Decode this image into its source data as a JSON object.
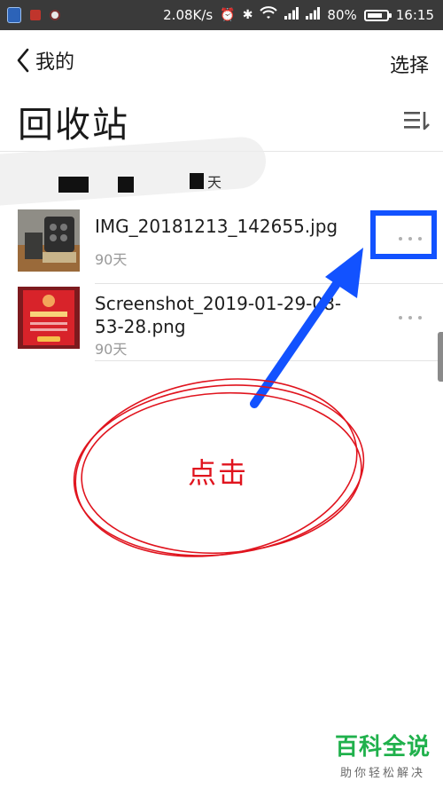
{
  "status_bar": {
    "network_speed": "2.08K/s",
    "battery": "80%",
    "battery_level": 0.8,
    "time": "16:15"
  },
  "header": {
    "back_label": "我的",
    "select_label": "选择",
    "title": "回收站"
  },
  "notice": {
    "text": "天"
  },
  "files": [
    {
      "name": "IMG_20181213_142655.jpg",
      "age": "90天"
    },
    {
      "name": "Screenshot_2019-01-29-08-53-28.png",
      "age": "90天"
    }
  ],
  "annotation": {
    "label": "点击",
    "arrow_color": "#1252ff",
    "circle_color": "#e0141e"
  },
  "watermark": {
    "main": "百科全说",
    "sub": "助你轻松解决"
  }
}
